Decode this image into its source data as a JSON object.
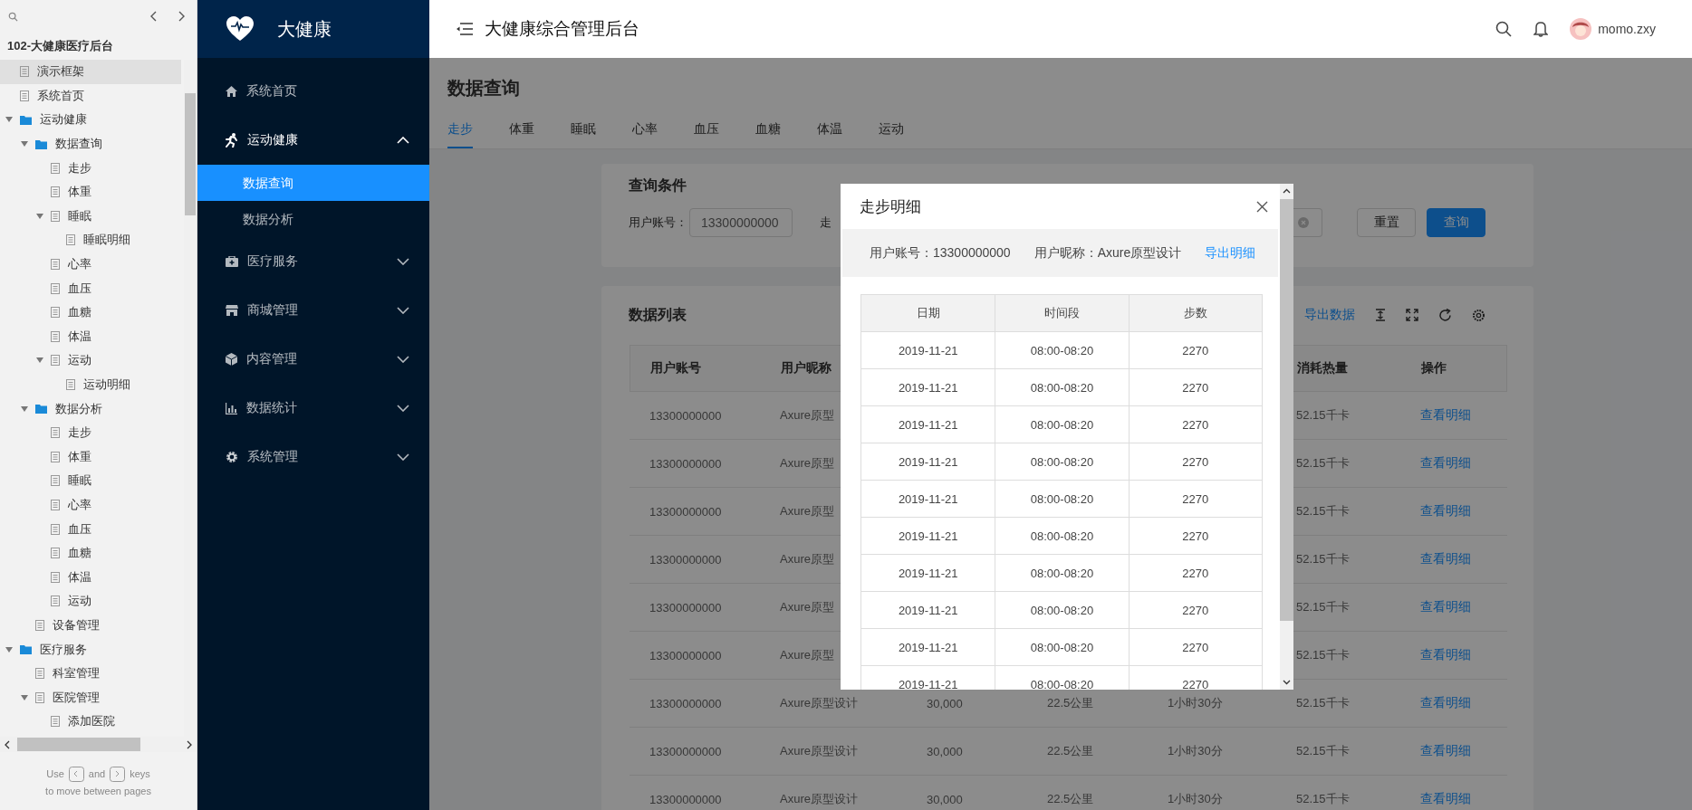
{
  "outline": {
    "title": "102-大健康医疗后台",
    "items": [
      {
        "label": "演示框架",
        "kind": "page",
        "selected": true
      },
      {
        "label": "系统首页",
        "kind": "page",
        "selected": false
      },
      {
        "label": "运动健康",
        "kind": "folder",
        "selected": false,
        "expanded": true,
        "children": [
          {
            "label": "数据查询",
            "kind": "folder",
            "selected": false,
            "expanded": true,
            "children": [
              {
                "label": "走步",
                "kind": "page",
                "selected": false
              },
              {
                "label": "体重",
                "kind": "page",
                "selected": false
              },
              {
                "label": "睡眠",
                "kind": "page",
                "selected": false,
                "expanded": true,
                "children": [
                  {
                    "label": "睡眠明细",
                    "kind": "page",
                    "selected": false
                  }
                ]
              },
              {
                "label": "心率",
                "kind": "page",
                "selected": false
              },
              {
                "label": "血压",
                "kind": "page",
                "selected": false
              },
              {
                "label": "血糖",
                "kind": "page",
                "selected": false
              },
              {
                "label": "体温",
                "kind": "page",
                "selected": false
              },
              {
                "label": "运动",
                "kind": "page",
                "selected": false,
                "expanded": true,
                "children": [
                  {
                    "label": "运动明细",
                    "kind": "page",
                    "selected": false
                  }
                ]
              }
            ]
          },
          {
            "label": "数据分析",
            "kind": "folder",
            "selected": false,
            "expanded": true,
            "children": [
              {
                "label": "走步",
                "kind": "page",
                "selected": false
              },
              {
                "label": "体重",
                "kind": "page",
                "selected": false
              },
              {
                "label": "睡眠",
                "kind": "page",
                "selected": false
              },
              {
                "label": "心率",
                "kind": "page",
                "selected": false
              },
              {
                "label": "血压",
                "kind": "page",
                "selected": false
              },
              {
                "label": "血糖",
                "kind": "page",
                "selected": false
              },
              {
                "label": "体温",
                "kind": "page",
                "selected": false
              },
              {
                "label": "运动",
                "kind": "page",
                "selected": false
              }
            ]
          },
          {
            "label": "设备管理",
            "kind": "page",
            "selected": false
          }
        ]
      },
      {
        "label": "医疗服务",
        "kind": "folder",
        "selected": false,
        "expanded": true,
        "children": [
          {
            "label": "科室管理",
            "kind": "page",
            "selected": false
          },
          {
            "label": "医院管理",
            "kind": "page",
            "selected": false,
            "expanded": true,
            "children": [
              {
                "label": "添加医院",
                "kind": "page",
                "selected": false
              }
            ]
          }
        ]
      }
    ],
    "hint": {
      "before": "Use",
      "middle": "and",
      "after": "keys",
      "second_line": "to move between pages"
    }
  },
  "sidebar": {
    "brand": "大健康",
    "items": [
      {
        "label": "系统首页"
      },
      {
        "label": "运动健康",
        "expanded": true,
        "children": [
          {
            "label": "数据查询",
            "selected": true
          },
          {
            "label": "数据分析",
            "selected": false
          }
        ]
      },
      {
        "label": "医疗服务",
        "expanded": false
      },
      {
        "label": "商城管理",
        "expanded": false
      },
      {
        "label": "内容管理",
        "expanded": false
      },
      {
        "label": "数据统计",
        "expanded": false
      },
      {
        "label": "系统管理",
        "expanded": false
      }
    ]
  },
  "header": {
    "title": "大健康综合管理后台",
    "user": "momo.zxy"
  },
  "page": {
    "title": "数据查询",
    "tabs": [
      {
        "label": "走步",
        "selected": true
      },
      {
        "label": "体重",
        "selected": false
      },
      {
        "label": "睡眠",
        "selected": false
      },
      {
        "label": "心率",
        "selected": false
      },
      {
        "label": "血压",
        "selected": false
      },
      {
        "label": "血糖",
        "selected": false
      },
      {
        "label": "体温",
        "selected": false
      },
      {
        "label": "运动",
        "selected": false
      }
    ]
  },
  "query": {
    "title": "查询条件",
    "account_label": "用户账号：",
    "account_value": "13300000000",
    "second_label": "走",
    "reset": "重置",
    "search": "查询"
  },
  "data_list": {
    "title": "数据列表",
    "export": "导出数据",
    "columns": [
      "用户账号",
      "用户昵称",
      null,
      null,
      null,
      "消耗热量",
      "操作"
    ],
    "rows": [
      {
        "cells": [
          "13300000000",
          "Axure原型",
          null,
          null,
          null,
          "52.15千卡"
        ],
        "action": "查看明细"
      },
      {
        "cells": [
          "13300000000",
          "Axure原型",
          null,
          null,
          null,
          "52.15千卡"
        ],
        "action": "查看明细"
      },
      {
        "cells": [
          "13300000000",
          "Axure原型",
          null,
          null,
          null,
          "52.15千卡"
        ],
        "action": "查看明细"
      },
      {
        "cells": [
          "13300000000",
          "Axure原型",
          null,
          null,
          null,
          "52.15千卡"
        ],
        "action": "查看明细"
      },
      {
        "cells": [
          "13300000000",
          "Axure原型",
          null,
          null,
          null,
          "52.15千卡"
        ],
        "action": "查看明细"
      },
      {
        "cells": [
          "13300000000",
          "Axure原型",
          null,
          null,
          null,
          "52.15千卡"
        ],
        "action": "查看明细"
      },
      {
        "cells": [
          "13300000000",
          "Axure原型设计",
          "30,000",
          "22.5公里",
          "1小时30分",
          "52.15千卡"
        ],
        "action": "查看明细"
      },
      {
        "cells": [
          "13300000000",
          "Axure原型设计",
          "30,000",
          "22.5公里",
          "1小时30分",
          "52.15千卡"
        ],
        "action": "查看明细"
      },
      {
        "cells": [
          "13300000000",
          "Axure原型设计",
          "30,000",
          "22.5公里",
          "1小时30分",
          "52.15千卡"
        ],
        "action": "查看明细"
      }
    ]
  },
  "dialog": {
    "title": "走步明细",
    "account": "用户账号：13300000000",
    "nickname": "用户昵称：Axure原型设计",
    "export": "导出明细",
    "columns": [
      "日期",
      "时间段",
      "步数"
    ],
    "rows": [
      [
        "2019-11-21",
        "08:00-08:20",
        "2270"
      ],
      [
        "2019-11-21",
        "08:00-08:20",
        "2270"
      ],
      [
        "2019-11-21",
        "08:00-08:20",
        "2270"
      ],
      [
        "2019-11-21",
        "08:00-08:20",
        "2270"
      ],
      [
        "2019-11-21",
        "08:00-08:20",
        "2270"
      ],
      [
        "2019-11-21",
        "08:00-08:20",
        "2270"
      ],
      [
        "2019-11-21",
        "08:00-08:20",
        "2270"
      ],
      [
        "2019-11-21",
        "08:00-08:20",
        "2270"
      ],
      [
        "2019-11-21",
        "08:00-08:20",
        "2270"
      ],
      [
        "2019-11-21",
        "08:00-08:20",
        "2270"
      ]
    ]
  }
}
